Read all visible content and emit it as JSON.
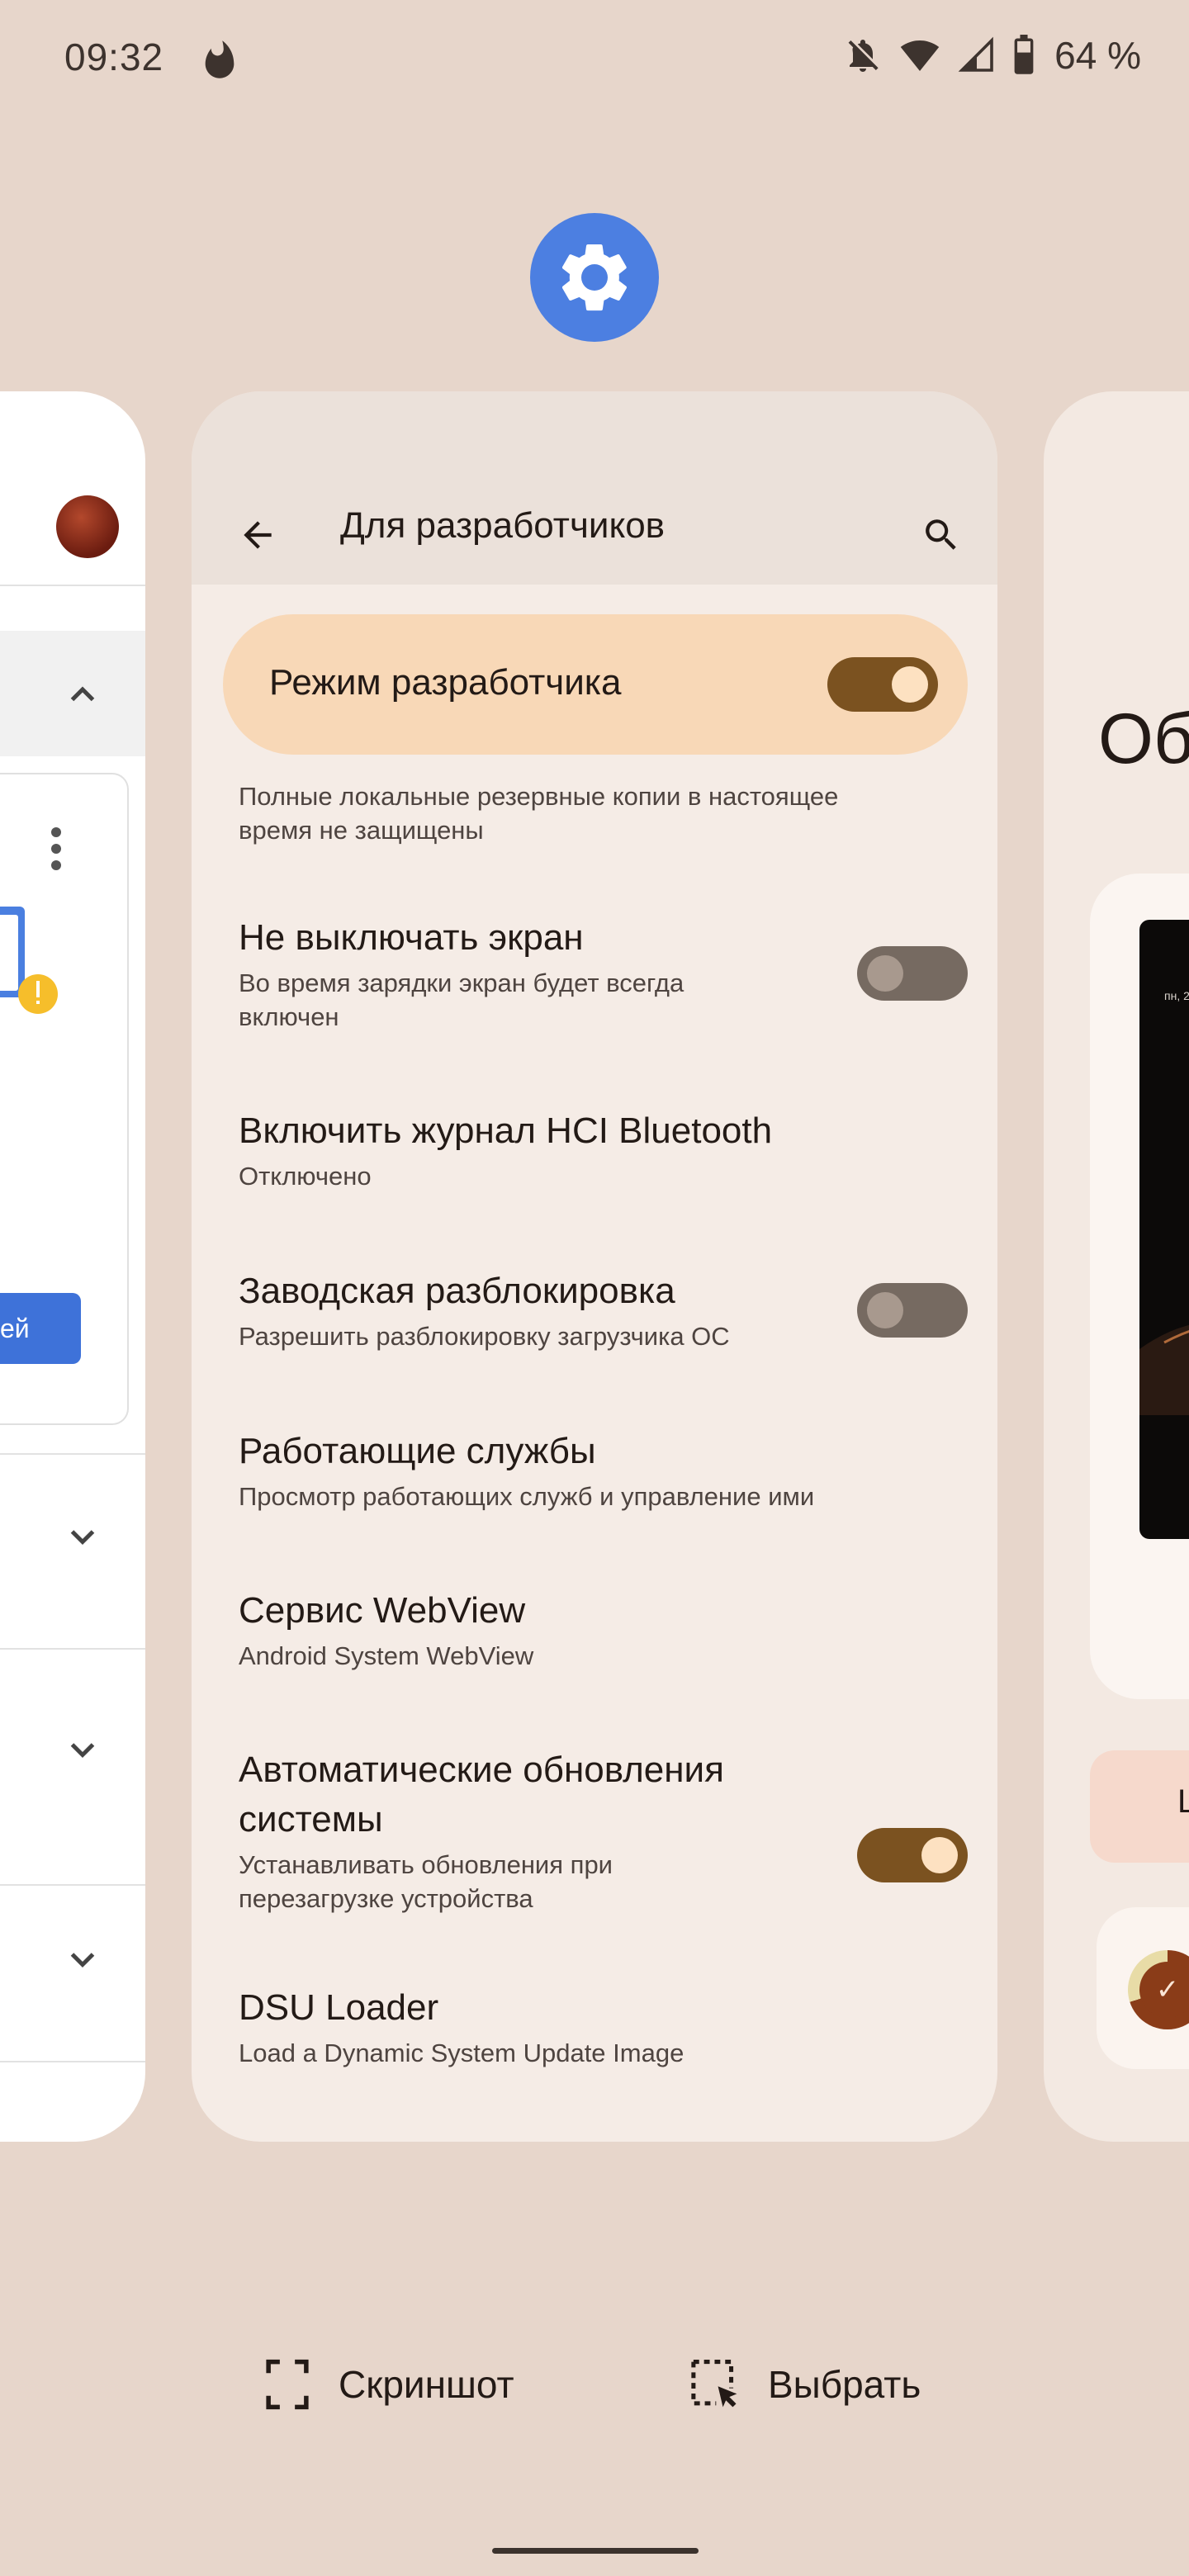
{
  "status_bar": {
    "time": "09:32",
    "battery": "64 %",
    "icons": [
      "fire-notification-icon",
      "bell-off-icon",
      "wifi-icon",
      "signal-icon",
      "battery-icon"
    ]
  },
  "app_icon": "settings-gear-icon",
  "main_card": {
    "title": "Для разработчиков",
    "master_toggle": {
      "label": "Режим разработчика",
      "on": true
    },
    "truncated_text": "Полные локальные резервные копии в настоящее время не защищены",
    "preferences": [
      {
        "title": "Не выключать экран",
        "subtitle": "Во время зарядки экран будет всегда включен",
        "toggle": "off"
      },
      {
        "title": "Включить журнал HCI Bluetooth",
        "subtitle": "Отключено",
        "toggle": null
      },
      {
        "title": "Заводская разблокировка",
        "subtitle": "Разрешить разблокировку загрузчика ОС",
        "toggle": "off"
      },
      {
        "title": "Работающие службы",
        "subtitle": "Просмотр работающих служб и управление ими",
        "toggle": null
      },
      {
        "title": "Сервис WebView",
        "subtitle": "Android System WebView",
        "toggle": null
      },
      {
        "title": "Автоматические обновления системы",
        "subtitle": "Устанавливать обновления при перезагрузке устройства",
        "toggle": "on"
      },
      {
        "title": "DSU Loader",
        "subtitle": "Load a Dynamic System Update Image",
        "toggle": null
      }
    ]
  },
  "left_card": {
    "button_fragment": "ей",
    "password_fragment": "**"
  },
  "right_card": {
    "heading_fragment": "Об",
    "phone_text": "пн, 2",
    "pill_fragment": "L",
    "check_mark": "✓"
  },
  "actions": {
    "screenshot_label": "Скриншот",
    "select_label": "Выбрать"
  },
  "colors": {
    "background": "#e7d6cb",
    "card": "#f5ece6",
    "accent_toggle": "#7b5220",
    "master_bg": "#f8d8b7",
    "app_icon_blue": "#4c7fe1"
  }
}
